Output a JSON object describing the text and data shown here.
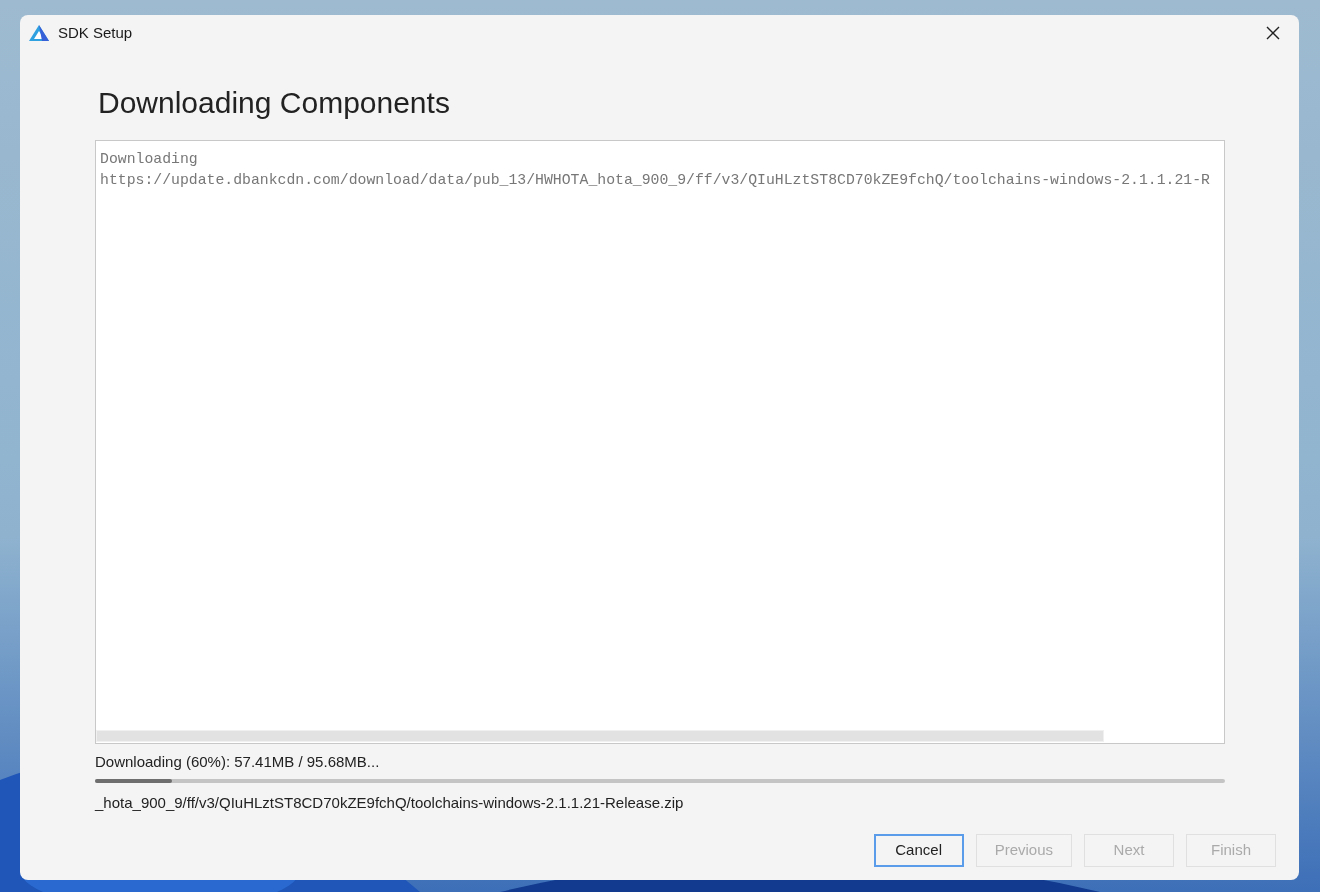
{
  "window": {
    "title": "SDK Setup",
    "heading": "Downloading Components"
  },
  "log": {
    "lines": [
      "Downloading",
      "https://update.dbankcdn.com/download/data/pub_13/HWHOTA_hota_900_9/ff/v3/QIuHLztST8CD70kZE9fchQ/toolchains-windows-2.1.1.21-R"
    ]
  },
  "progress": {
    "status": "Downloading (60%): 57.41MB / 95.68MB...",
    "level": 0.068,
    "file": "_hota_900_9/ff/v3/QIuHLztST8CD70kZE9fchQ/toolchains-windows-2.1.1.21-Release.zip"
  },
  "buttons": [
    {
      "label": "Cancel",
      "disabled": false,
      "focused": true
    },
    {
      "label": "Previous",
      "disabled": true,
      "focused": false
    },
    {
      "label": "Next",
      "disabled": true,
      "focused": false
    },
    {
      "label": "Finish",
      "disabled": true,
      "focused": false
    }
  ]
}
